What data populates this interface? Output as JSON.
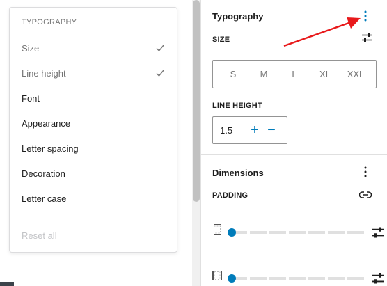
{
  "menu": {
    "heading": "TYPOGRAPHY",
    "items": [
      {
        "label": "Size",
        "checked": true
      },
      {
        "label": "Line height",
        "checked": true
      },
      {
        "label": "Font",
        "checked": false
      },
      {
        "label": "Appearance",
        "checked": false
      },
      {
        "label": "Letter spacing",
        "checked": false
      },
      {
        "label": "Decoration",
        "checked": false
      },
      {
        "label": "Letter case",
        "checked": false
      }
    ],
    "reset_label": "Reset all"
  },
  "sidebar": {
    "typography": {
      "title": "Typography",
      "size_label": "SIZE",
      "size_options": [
        "S",
        "M",
        "L",
        "XL",
        "XXL"
      ],
      "line_height_label": "LINE HEIGHT",
      "line_height_value": "1.5",
      "increment": "+",
      "decrement": "−"
    },
    "dimensions": {
      "title": "Dimensions",
      "padding_label": "PADDING"
    }
  },
  "colors": {
    "accent": "#007cba",
    "annotation_arrow": "#e8191b",
    "muted_text": "#757575"
  }
}
